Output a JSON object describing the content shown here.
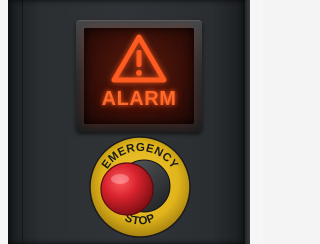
{
  "alarm_display": {
    "label": "ALARM",
    "icon": "warning-triangle-icon",
    "glow_color": "#ff5a1f"
  },
  "emergency_stop": {
    "top_label": "EMERGENCY",
    "bottom_label": "STOP",
    "ring_color": "#e0b41a",
    "button_color": "#c8202a"
  },
  "panel": {
    "color": "#2e3235"
  }
}
